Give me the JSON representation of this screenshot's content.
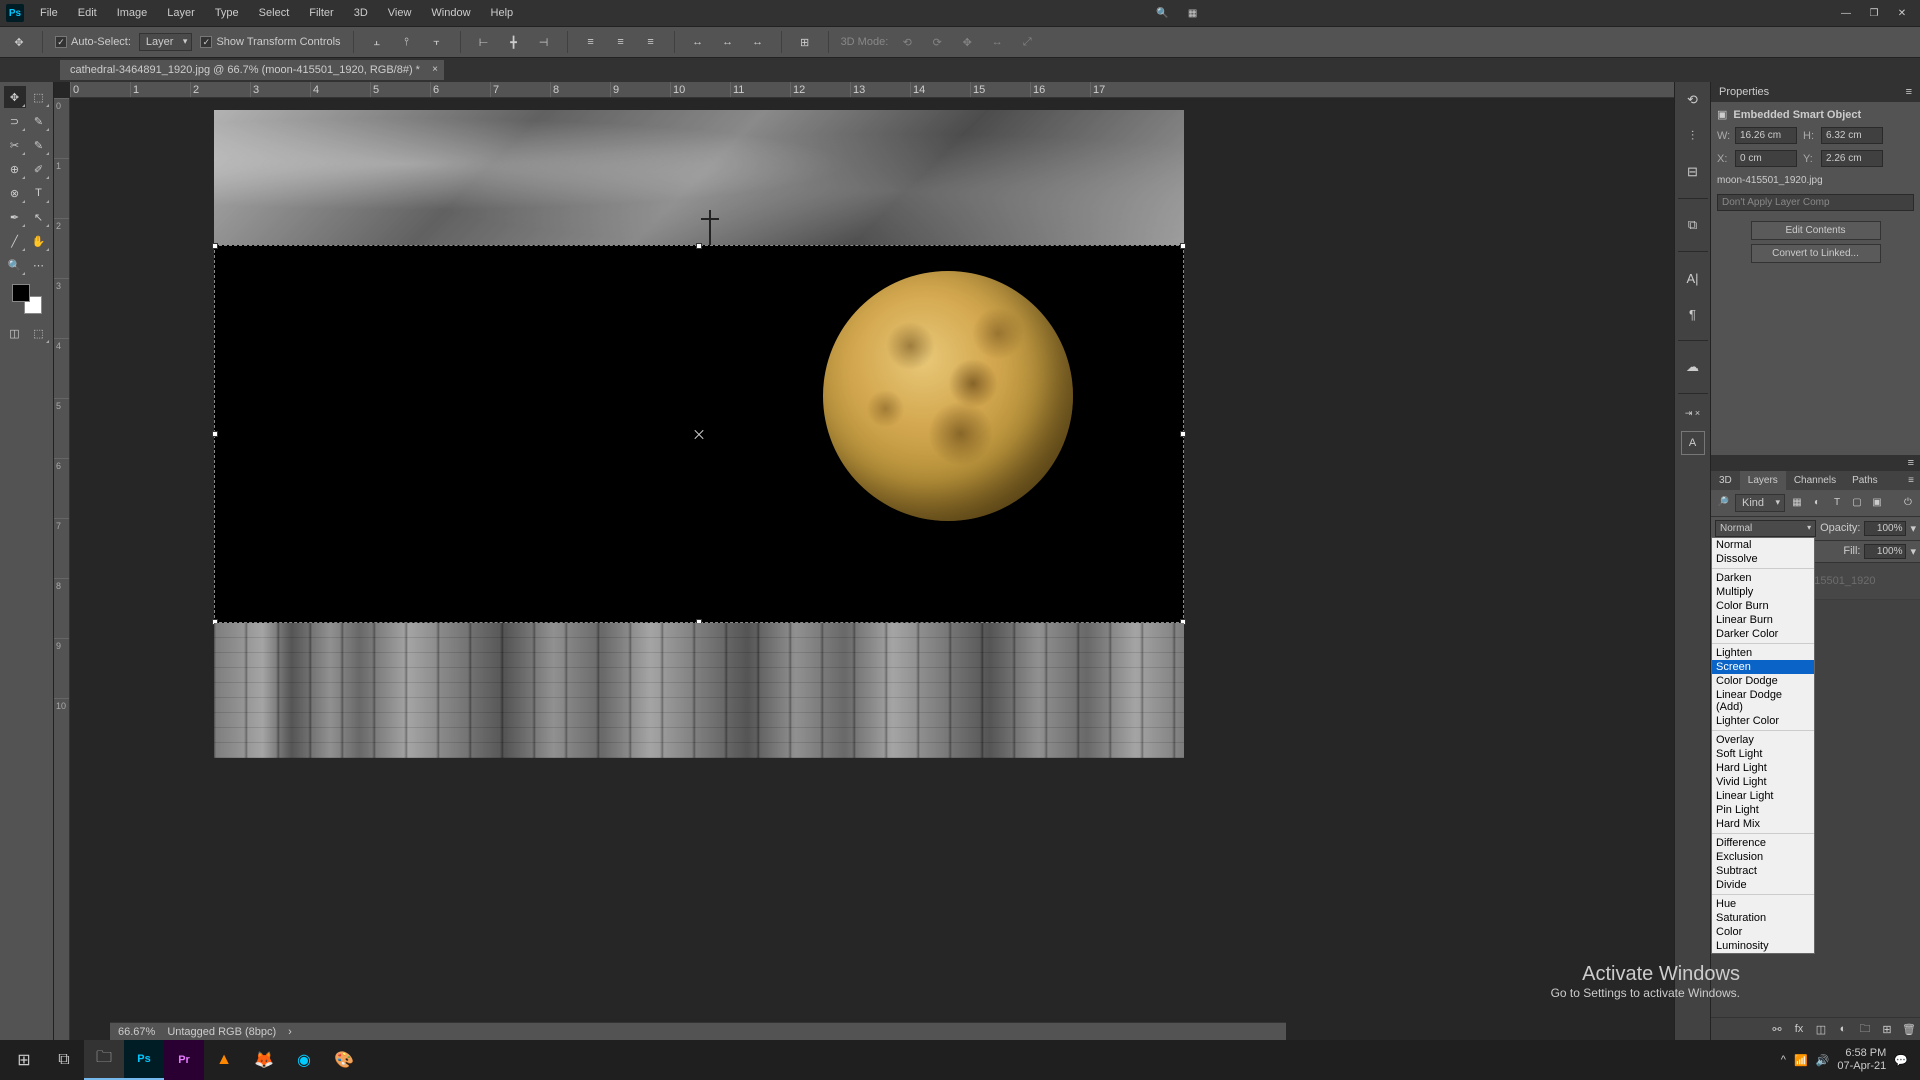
{
  "menu": [
    "File",
    "Edit",
    "Image",
    "Layer",
    "Type",
    "Select",
    "Filter",
    "3D",
    "View",
    "Window",
    "Help"
  ],
  "options": {
    "auto_select": "Auto-Select:",
    "layer": "Layer",
    "show_transform": "Show Transform Controls",
    "mode_3d": "3D Mode:"
  },
  "doc_tab": "cathedral-3464891_1920.jpg @ 66.7% (moon-415501_1920, RGB/8#) *",
  "ruler_h": [
    "0",
    "1",
    "2",
    "3",
    "4",
    "5",
    "6",
    "7",
    "8",
    "9",
    "10",
    "11",
    "12",
    "13",
    "14",
    "15",
    "16",
    "17"
  ],
  "ruler_v": [
    "0",
    "1",
    "2",
    "3",
    "4",
    "5",
    "6",
    "7",
    "8",
    "9",
    "10"
  ],
  "properties": {
    "title": "Properties",
    "type": "Embedded Smart Object",
    "w_label": "W:",
    "w": "16.26 cm",
    "h_label": "H:",
    "h": "6.32 cm",
    "x_label": "X:",
    "x": "0 cm",
    "y_label": "Y:",
    "y": "2.26 cm",
    "filename": "moon-415501_1920.jpg",
    "layer_comp": "Don't Apply Layer Comp",
    "edit": "Edit Contents",
    "convert": "Convert to Linked..."
  },
  "layers": {
    "tabs": [
      "3D",
      "Layers",
      "Channels",
      "Paths"
    ],
    "kind": "Kind",
    "blend": "Normal",
    "opacity_label": "Opacity:",
    "opacity": "100%",
    "fill_label": "Fill:",
    "fill": "100%",
    "layer_name": "moon-415501_1920"
  },
  "blend_modes": {
    "g1": [
      "Normal",
      "Dissolve"
    ],
    "g2": [
      "Darken",
      "Multiply",
      "Color Burn",
      "Linear Burn",
      "Darker Color"
    ],
    "g3": [
      "Lighten",
      "Screen",
      "Color Dodge",
      "Linear Dodge (Add)",
      "Lighter Color"
    ],
    "g4": [
      "Overlay",
      "Soft Light",
      "Hard Light",
      "Vivid Light",
      "Linear Light",
      "Pin Light",
      "Hard Mix"
    ],
    "g5": [
      "Difference",
      "Exclusion",
      "Subtract",
      "Divide"
    ],
    "g6": [
      "Hue",
      "Saturation",
      "Color",
      "Luminosity"
    ],
    "highlighted": "Screen"
  },
  "status": {
    "zoom": "66.67%",
    "info": "Untagged RGB (8bpc)"
  },
  "watermark": {
    "l1": "Activate Windows",
    "l2": "Go to Settings to activate Windows."
  },
  "clock": {
    "time": "6:58 PM",
    "date": "07-Apr-21"
  }
}
